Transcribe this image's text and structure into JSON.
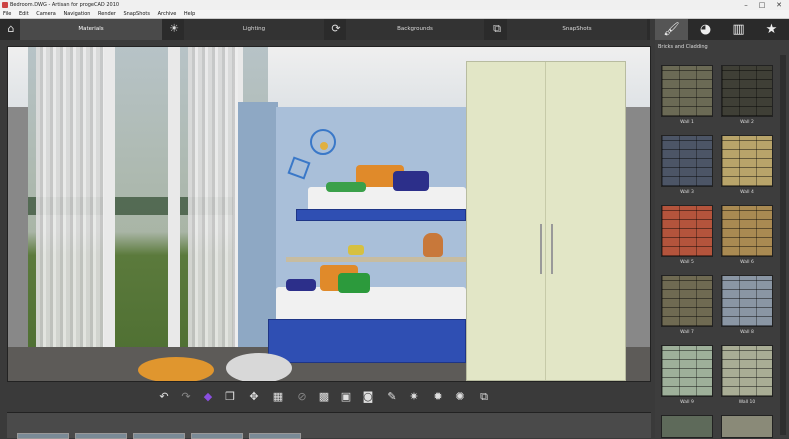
{
  "window": {
    "title": "Bedroom.DWG - Artisan for progeCAD 2010",
    "controls": [
      "–",
      "□",
      "✕"
    ]
  },
  "menu": [
    "File",
    "Edit",
    "Camera",
    "Navigation",
    "Render",
    "SnapShots",
    "Archive",
    "Help"
  ],
  "tabs": [
    {
      "label": "Materials",
      "icon": "house-icon",
      "active": true
    },
    {
      "label": "Lighting",
      "icon": "lightbulb-icon",
      "active": false
    },
    {
      "label": "Backgrounds",
      "icon": "background-icon",
      "active": false
    },
    {
      "label": "SnapShots",
      "icon": "snapshot-icon",
      "active": false
    }
  ],
  "right_panel": {
    "tabs": [
      {
        "icon": "brush-icon",
        "glyph": "🖌",
        "active": true
      },
      {
        "icon": "palette-icon",
        "glyph": "◕",
        "active": false
      },
      {
        "icon": "books-icon",
        "glyph": "▥",
        "active": false
      },
      {
        "icon": "star-icon",
        "glyph": "★",
        "active": false
      }
    ],
    "category": "Bricks and Cladding",
    "swatches": [
      {
        "label": "Wall 1",
        "color": "#6b6a55"
      },
      {
        "label": "Wall 2",
        "color": "#3f3f36"
      },
      {
        "label": "Wall 3",
        "color": "#4c5566"
      },
      {
        "label": "Wall 4",
        "color": "#b8a46a"
      },
      {
        "label": "Wall 5",
        "color": "#b4543c"
      },
      {
        "label": "Wall 6",
        "color": "#a98a52"
      },
      {
        "label": "Wall 7",
        "color": "#6f6a52"
      },
      {
        "label": "Wall 8",
        "color": "#8a96a4"
      },
      {
        "label": "Wall 9",
        "color": "#9eb09a"
      },
      {
        "label": "Wall 10",
        "color": "#a9ad95"
      }
    ]
  },
  "toolbar": [
    {
      "icon": "undo-icon",
      "glyph": "↶"
    },
    {
      "icon": "redo-icon",
      "glyph": "↷"
    },
    {
      "icon": "material-icon",
      "glyph": "◆"
    },
    {
      "icon": "cube-icon",
      "glyph": "❒"
    },
    {
      "icon": "move-icon",
      "glyph": "✥"
    },
    {
      "icon": "grid-icon",
      "glyph": "▦"
    },
    {
      "icon": "disabled-icon",
      "glyph": "⊘"
    },
    {
      "icon": "pattern-icon",
      "glyph": "▩"
    },
    {
      "icon": "frame-icon",
      "glyph": "▣"
    },
    {
      "icon": "camera-icon",
      "glyph": "◙"
    },
    {
      "icon": "eyedropper-icon",
      "glyph": "✎"
    },
    {
      "icon": "light-add-icon",
      "glyph": "✷"
    },
    {
      "icon": "light-edit-icon",
      "glyph": "✹"
    },
    {
      "icon": "light-settings-icon",
      "glyph": "✺"
    },
    {
      "icon": "preview-icon",
      "glyph": "⧉"
    }
  ]
}
